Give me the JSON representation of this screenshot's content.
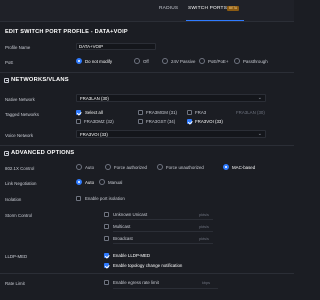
{
  "tabs": {
    "radius": "RADIUS",
    "switch_ports": "SWITCH PORTS",
    "beta_badge": "BETA"
  },
  "page_title": "EDIT SWITCH PORT PROFILE - DATA+VOIP",
  "profile_name": {
    "label": "Profile Name",
    "value": "DATA+VOIP"
  },
  "poe": {
    "label": "PoE",
    "options": [
      "Do not modify",
      "Off",
      "24V Passive",
      "PoE/PoE+",
      "Passthrough"
    ],
    "selected": "Do not modify"
  },
  "networks_section": {
    "title": "NETWORKS/VLANS",
    "native_network_label": "Native Network",
    "native_network_value": "FRA3LAN (30)",
    "tagged_networks_label": "Tagged Networks",
    "select_all_label": "Select all",
    "tagged_networks": [
      {
        "label": "FRA3MGM (31)",
        "checked": false
      },
      {
        "label": "FRA3",
        "checked": false
      },
      {
        "label": "FRA3LAN (30)",
        "checked": false,
        "disabled": true
      },
      {
        "label": "FRA3DMZ (32)",
        "checked": false
      },
      {
        "label": "FRA3GST (34)",
        "checked": false
      },
      {
        "label": "FRA3VOI (33)",
        "checked": true
      }
    ],
    "voice_network_label": "Voice Network",
    "voice_network_value": "FRA3VOI (33)"
  },
  "advanced_section": {
    "title": "ADVANCED OPTIONS",
    "dot1x": {
      "label": "802.1X Control",
      "options": [
        "Auto",
        "Force authorized",
        "Force unauthorized",
        "MAC-based"
      ],
      "selected": "MAC-based"
    },
    "link_negotiation": {
      "label": "Link Negotiation",
      "options": [
        "Auto",
        "Manual"
      ],
      "selected": "Auto"
    },
    "isolation": {
      "label": "Isolation",
      "checkbox_label": "Enable port isolation",
      "checked": false
    },
    "storm_control": {
      "label": "Storm Control",
      "items": [
        {
          "label": "Unknown Unicast",
          "unit": "pkts/s",
          "checked": false
        },
        {
          "label": "Multicast",
          "unit": "pkts/s",
          "checked": false
        },
        {
          "label": "Broadcast",
          "unit": "pkts/s",
          "checked": false
        }
      ]
    },
    "lldp_med": {
      "label": "LLDP-MED",
      "enable_label": "Enable LLDP-MED",
      "enable_checked": true,
      "topology_label": "Enable topology change notification",
      "topology_checked": true
    },
    "rate_limit": {
      "label": "Rate Limit",
      "checkbox_label": "Enable egress rate limit",
      "unit": "kbps",
      "checked": false
    }
  }
}
